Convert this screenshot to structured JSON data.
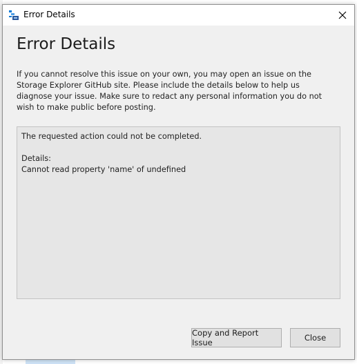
{
  "window": {
    "title": "Error Details",
    "icon": "storage-explorer-icon",
    "close_glyph": "✕"
  },
  "dialog": {
    "heading": "Error Details",
    "description": "If you cannot resolve this issue on your own, you may open an issue on the Storage Explorer GitHub site. Please include the details below to help us diagnose your issue. Make sure to redact any personal information you do not wish to make public before posting.",
    "details": {
      "line1": "The requested action could not be completed.",
      "line2": "",
      "line3": "Details:",
      "line4": "Cannot read property 'name' of undefined"
    }
  },
  "buttons": {
    "report_label": "Copy and Report Issue",
    "close_label": "Close"
  },
  "colors": {
    "accent": "#0078d7",
    "dialog_bg": "#f0f0f0",
    "details_bg": "#e6e6e6"
  }
}
